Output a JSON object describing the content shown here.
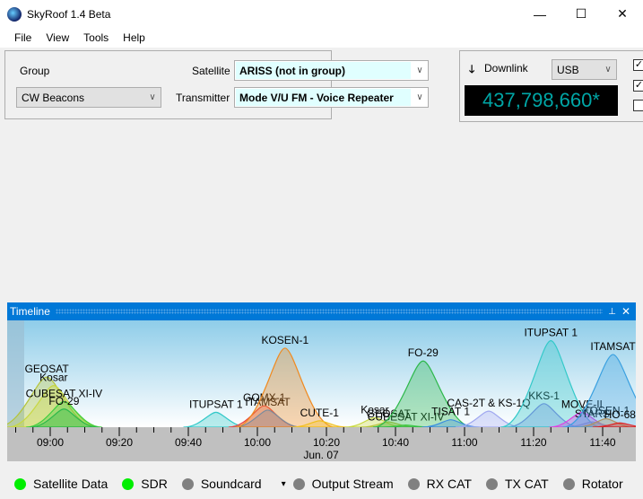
{
  "window": {
    "title": "SkyRoof 1.4 Beta",
    "minimize": "—",
    "maximize": "☐",
    "close": "✕"
  },
  "menu": [
    "File",
    "View",
    "Tools",
    "Help"
  ],
  "selector": {
    "group_label": "Group",
    "group_value": "CW Beacons",
    "satellite_label": "Satellite",
    "satellite_value": "ARISS (not in group)",
    "transmitter_label": "Transmitter",
    "transmitter_value": "Mode V/U FM - Voice Repeater"
  },
  "radio": {
    "downlink_label": "Downlink",
    "arrow": "🡓",
    "mode_value": "USB",
    "frequency": "437,798,660*",
    "checkboxes": [
      true,
      true,
      false
    ]
  },
  "timeline": {
    "title": "Timeline",
    "pin": "📌",
    "close": "✕",
    "date_label": "Jun. 07",
    "tick_labels": [
      "09:00",
      "09:20",
      "09:40",
      "10:00",
      "10:20",
      "10:40",
      "11:00",
      "11:20",
      "11:40"
    ],
    "passes": [
      {
        "name": "GEOSAT",
        "peak": "08:59",
        "level": 0.47,
        "color": "#b5c43a"
      },
      {
        "name": "Kosar",
        "peak": "09:01",
        "level": 0.39,
        "color": "#c8d840"
      },
      {
        "name": "CUBESAT XI-IV",
        "peak": "09:04",
        "level": 0.24,
        "color": "#3ecf3e"
      },
      {
        "name": "FO-29",
        "peak": "09:04",
        "level": 0.17,
        "color": "#2cb84a"
      },
      {
        "name": "ITUPSAT 1",
        "peak": "09:48",
        "level": 0.14,
        "color": "#33c9c9"
      },
      {
        "name": "GOMX-1",
        "peak": "10:02",
        "level": 0.2,
        "color": "#e84040"
      },
      {
        "name": "ITAMSAT",
        "peak": "10:03",
        "level": 0.16,
        "color": "#3a8de0"
      },
      {
        "name": "KOSEN-1",
        "peak": "10:08",
        "level": 0.74,
        "color": "#f08a20"
      },
      {
        "name": "CUTE-1",
        "peak": "10:18",
        "level": 0.06,
        "color": "#f0c020"
      },
      {
        "name": "Kosar",
        "peak": "10:34",
        "level": 0.09,
        "color": "#c8d840"
      },
      {
        "name": "GEOSAT",
        "peak": "10:38",
        "level": 0.05,
        "color": "#b5c43a"
      },
      {
        "name": "CUBESAT XI-IV",
        "peak": "10:43",
        "level": 0.02,
        "color": "#3ecf3e"
      },
      {
        "name": "FO-29",
        "peak": "10:48",
        "level": 0.62,
        "color": "#2cb84a"
      },
      {
        "name": "TISAT 1",
        "peak": "10:56",
        "level": 0.07,
        "color": "#3a8de0"
      },
      {
        "name": "CAS-2T & KS-1Q",
        "peak": "11:07",
        "level": 0.15,
        "color": "#a0a8f0"
      },
      {
        "name": "KKS-1",
        "peak": "11:23",
        "level": 0.22,
        "color": "#8080e0"
      },
      {
        "name": "ITUPSAT 1",
        "peak": "11:25",
        "level": 0.81,
        "color": "#33c9c9"
      },
      {
        "name": "MOVE-II",
        "peak": "11:34",
        "level": 0.14,
        "color": "#e040e0"
      },
      {
        "name": "STARS",
        "peak": "11:37",
        "level": 0.05,
        "color": "#a080d0"
      },
      {
        "name": "KOSEN-1",
        "peak": "11:41",
        "level": 0.08,
        "color": "#f08a20"
      },
      {
        "name": "ITAMSAT",
        "peak": "11:43",
        "level": 0.68,
        "color": "#3aa0e0"
      },
      {
        "name": "HO-68",
        "peak": "11:45",
        "level": 0.04,
        "color": "#e02020"
      }
    ]
  },
  "status": [
    {
      "label": "Satellite Data",
      "color": "#00ee00"
    },
    {
      "label": "SDR",
      "color": "#00ee00"
    },
    {
      "label": "Soundcard",
      "color": "#808080",
      "dropdown": "▾"
    },
    {
      "label": "Output Stream",
      "color": "#808080"
    },
    {
      "label": "RX CAT",
      "color": "#808080"
    },
    {
      "label": "TX CAT",
      "color": "#808080"
    },
    {
      "label": "Rotator",
      "color": "#808080"
    }
  ]
}
